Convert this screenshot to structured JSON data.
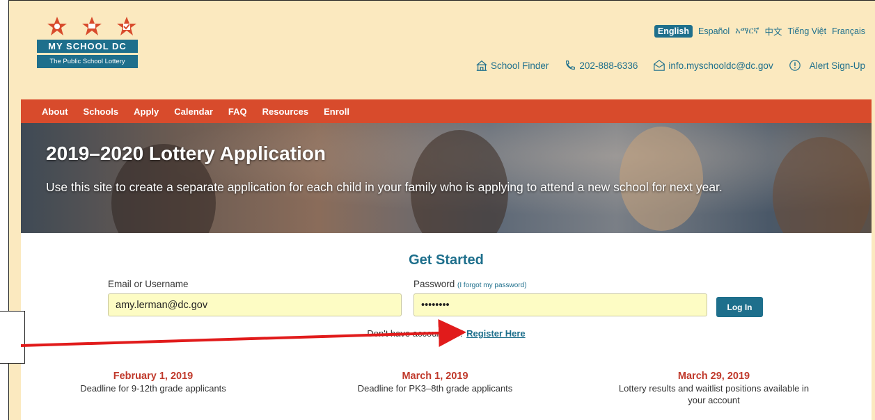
{
  "brand": {
    "title": "MY SCHOOL DC",
    "subtitle": "The Public School Lottery",
    "star_color": "#d84b2c"
  },
  "languages": [
    "English",
    "Español",
    "አማርኛ",
    "中文",
    "Tiếng Việt",
    "Français"
  ],
  "active_language": "English",
  "utility": {
    "school_finder": "School Finder",
    "phone": "202-888-6336",
    "email": "info.myschooldc@dc.gov",
    "alert": "Alert Sign-Up"
  },
  "nav": [
    "About",
    "Schools",
    "Apply",
    "Calendar",
    "FAQ",
    "Resources",
    "Enroll"
  ],
  "hero": {
    "title": "2019–2020 Lottery Application",
    "subtitle": "Use this site to create a separate application for each child in your family who is applying to attend a new school for next year."
  },
  "login": {
    "heading": "Get Started",
    "email_label": "Email or Username",
    "email_value": "amy.lerman@dc.gov",
    "password_label": "Password",
    "forgot_label": "(I forgot my password)",
    "password_value": "••••••••",
    "login_button": "Log In",
    "register_prompt": "Don't have account yet?",
    "register_link": "Register Here"
  },
  "deadlines": [
    {
      "date": "February 1, 2019",
      "desc": "Deadline for 9-12th grade applicants"
    },
    {
      "date": "March 1, 2019",
      "desc": "Deadline for PK3–8th grade applicants"
    },
    {
      "date": "March 29, 2019",
      "desc": "Lottery results and waitlist positions available in your account"
    }
  ],
  "colors": {
    "accent": "#1e6f8c",
    "nav_bg": "#d84b2c",
    "page_bg": "#fbe9bf",
    "arrow": "#e11b1b"
  }
}
